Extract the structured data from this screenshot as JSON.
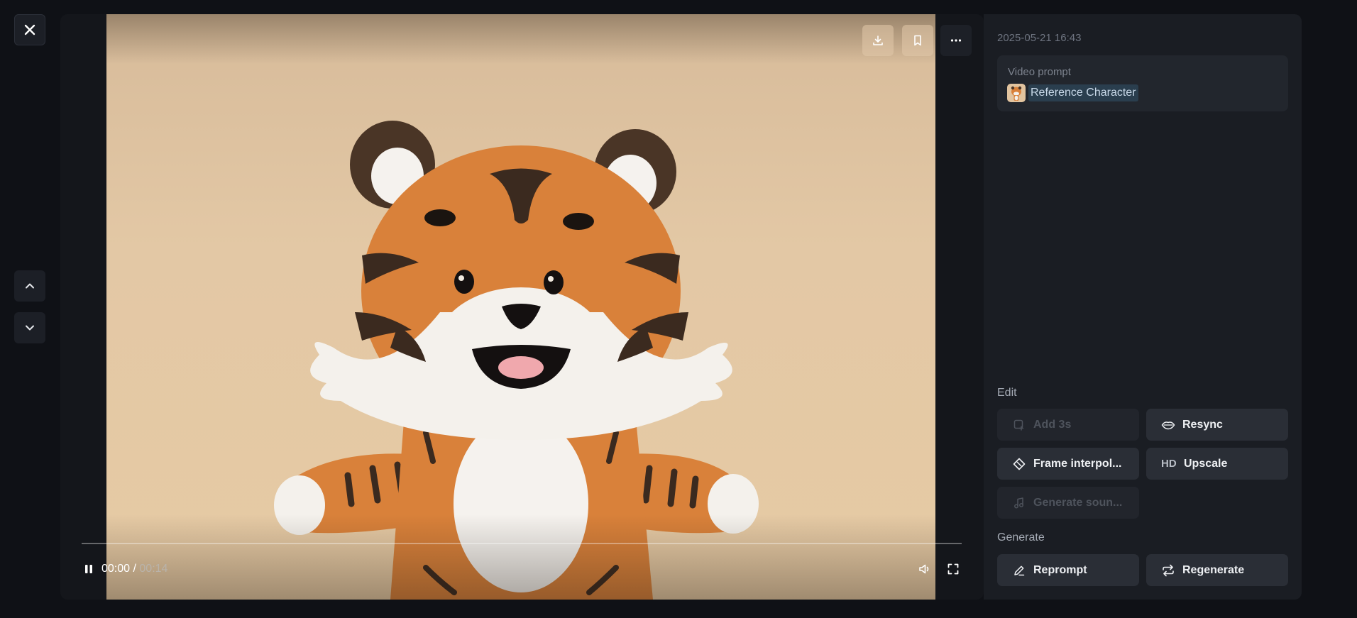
{
  "nav": {
    "close_icon": "close-icon",
    "up_icon": "chevron-up-icon",
    "down_icon": "chevron-down-icon"
  },
  "viewer": {
    "top_actions": [
      "download-icon",
      "bookmark-icon",
      "more-icon"
    ],
    "player": {
      "current_time": "00:00 /",
      "duration": "00:14",
      "progress": 0.0
    }
  },
  "panel": {
    "timestamp": "2025-05-21 16:43",
    "prompt": {
      "label": "Video prompt",
      "reference": "Reference Character"
    },
    "edit": {
      "label": "Edit",
      "actions": [
        {
          "label": "Add 3s",
          "icon": "add-clip-icon",
          "enabled": false
        },
        {
          "label": "Resync",
          "icon": "lips-icon",
          "enabled": true
        },
        {
          "label": "Frame interpol...",
          "icon": "diamond-icon",
          "enabled": true
        },
        {
          "label": "Upscale",
          "icon": "hd-icon",
          "icon_text": "HD",
          "enabled": true
        },
        {
          "label": "Generate soun...",
          "icon": "music-icon",
          "enabled": false
        }
      ]
    },
    "generate": {
      "label": "Generate",
      "actions": [
        {
          "label": "Reprompt",
          "icon": "pencil-icon",
          "enabled": true
        },
        {
          "label": "Regenerate",
          "icon": "repeat-icon",
          "enabled": true
        }
      ]
    }
  },
  "colors": {
    "background": "#0f1116",
    "panel": "#1a1d23",
    "button": "#2a2e36",
    "chip_highlight": "#2a3e4e"
  }
}
